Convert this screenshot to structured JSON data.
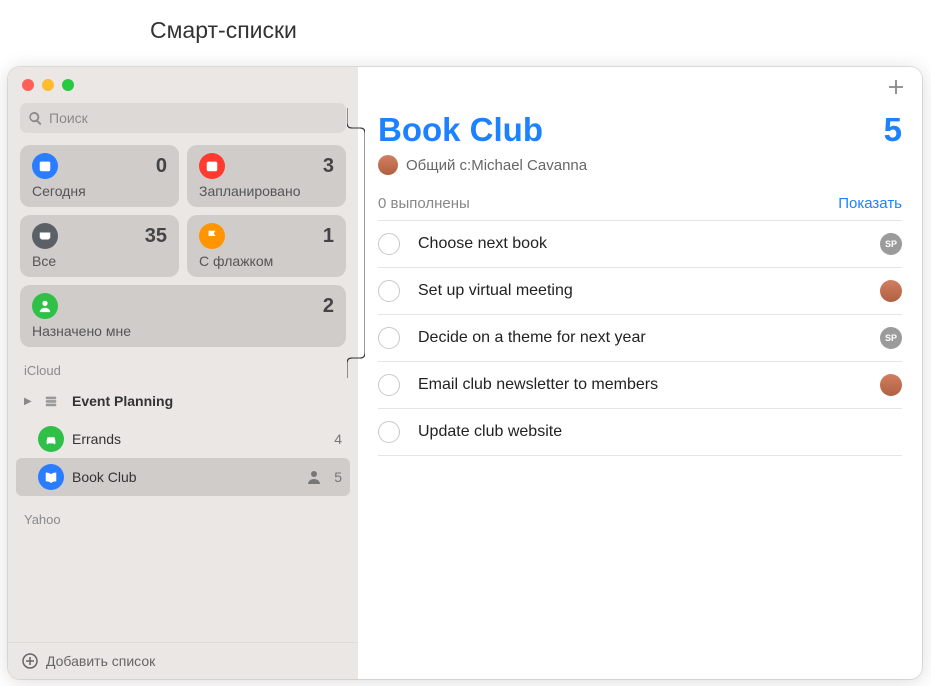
{
  "callout": "Смарт-списки",
  "search": {
    "placeholder": "Поиск"
  },
  "smart": {
    "today": {
      "label": "Сегодня",
      "count": "0",
      "color": "#2b7dff"
    },
    "scheduled": {
      "label": "Запланировано",
      "count": "3",
      "color": "#ff3b30"
    },
    "all": {
      "label": "Все",
      "count": "35",
      "color": "#5b6066"
    },
    "flagged": {
      "label": "С флажком",
      "count": "1",
      "color": "#ff9500"
    },
    "assigned": {
      "label": "Назначено мне",
      "count": "2",
      "color": "#30c048"
    }
  },
  "accounts": {
    "icloud": {
      "label": "iCloud"
    },
    "yahoo": {
      "label": "Yahoo"
    }
  },
  "lists": {
    "eventPlanning": {
      "name": "Event Planning"
    },
    "errands": {
      "name": "Errands",
      "count": "4",
      "color": "#30c048"
    },
    "bookClub": {
      "name": "Book Club",
      "count": "5",
      "color": "#2b7dff"
    }
  },
  "addList": "Добавить список",
  "main": {
    "title": "Book Club",
    "count": "5",
    "sharedPrefix": "Общий с: ",
    "sharedName": "Michael Cavanna",
    "completed": "0 выполнены",
    "show": "Показать"
  },
  "reminders": [
    {
      "text": "Choose next book",
      "assignee": "sp"
    },
    {
      "text": "Set up virtual meeting",
      "assignee": "ph"
    },
    {
      "text": "Decide on a theme for next year",
      "assignee": "sp"
    },
    {
      "text": "Email club newsletter to members",
      "assignee": "ph"
    },
    {
      "text": "Update club website",
      "assignee": ""
    }
  ]
}
